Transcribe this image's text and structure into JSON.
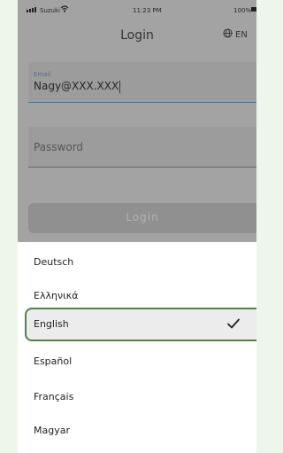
{
  "status_bar": {
    "carrier": "Suzuki",
    "time": "11:23 PM",
    "battery": "100%"
  },
  "header": {
    "title": "Login",
    "language_button": "EN"
  },
  "form": {
    "email_label": "Email",
    "email_value": "Nagy@XXX.XXX",
    "password_placeholder": "Password",
    "login_button": "Login"
  },
  "language_sheet": {
    "items": [
      {
        "label": "Deutsch"
      },
      {
        "label": "Ελληνικά"
      },
      {
        "label": "English",
        "selected": true
      },
      {
        "label": "Español"
      },
      {
        "label": "Français"
      },
      {
        "label": "Magyar"
      }
    ]
  },
  "colors": {
    "selected_border": "#5b7d4c",
    "dim_overlay": "#a3a3a3"
  }
}
